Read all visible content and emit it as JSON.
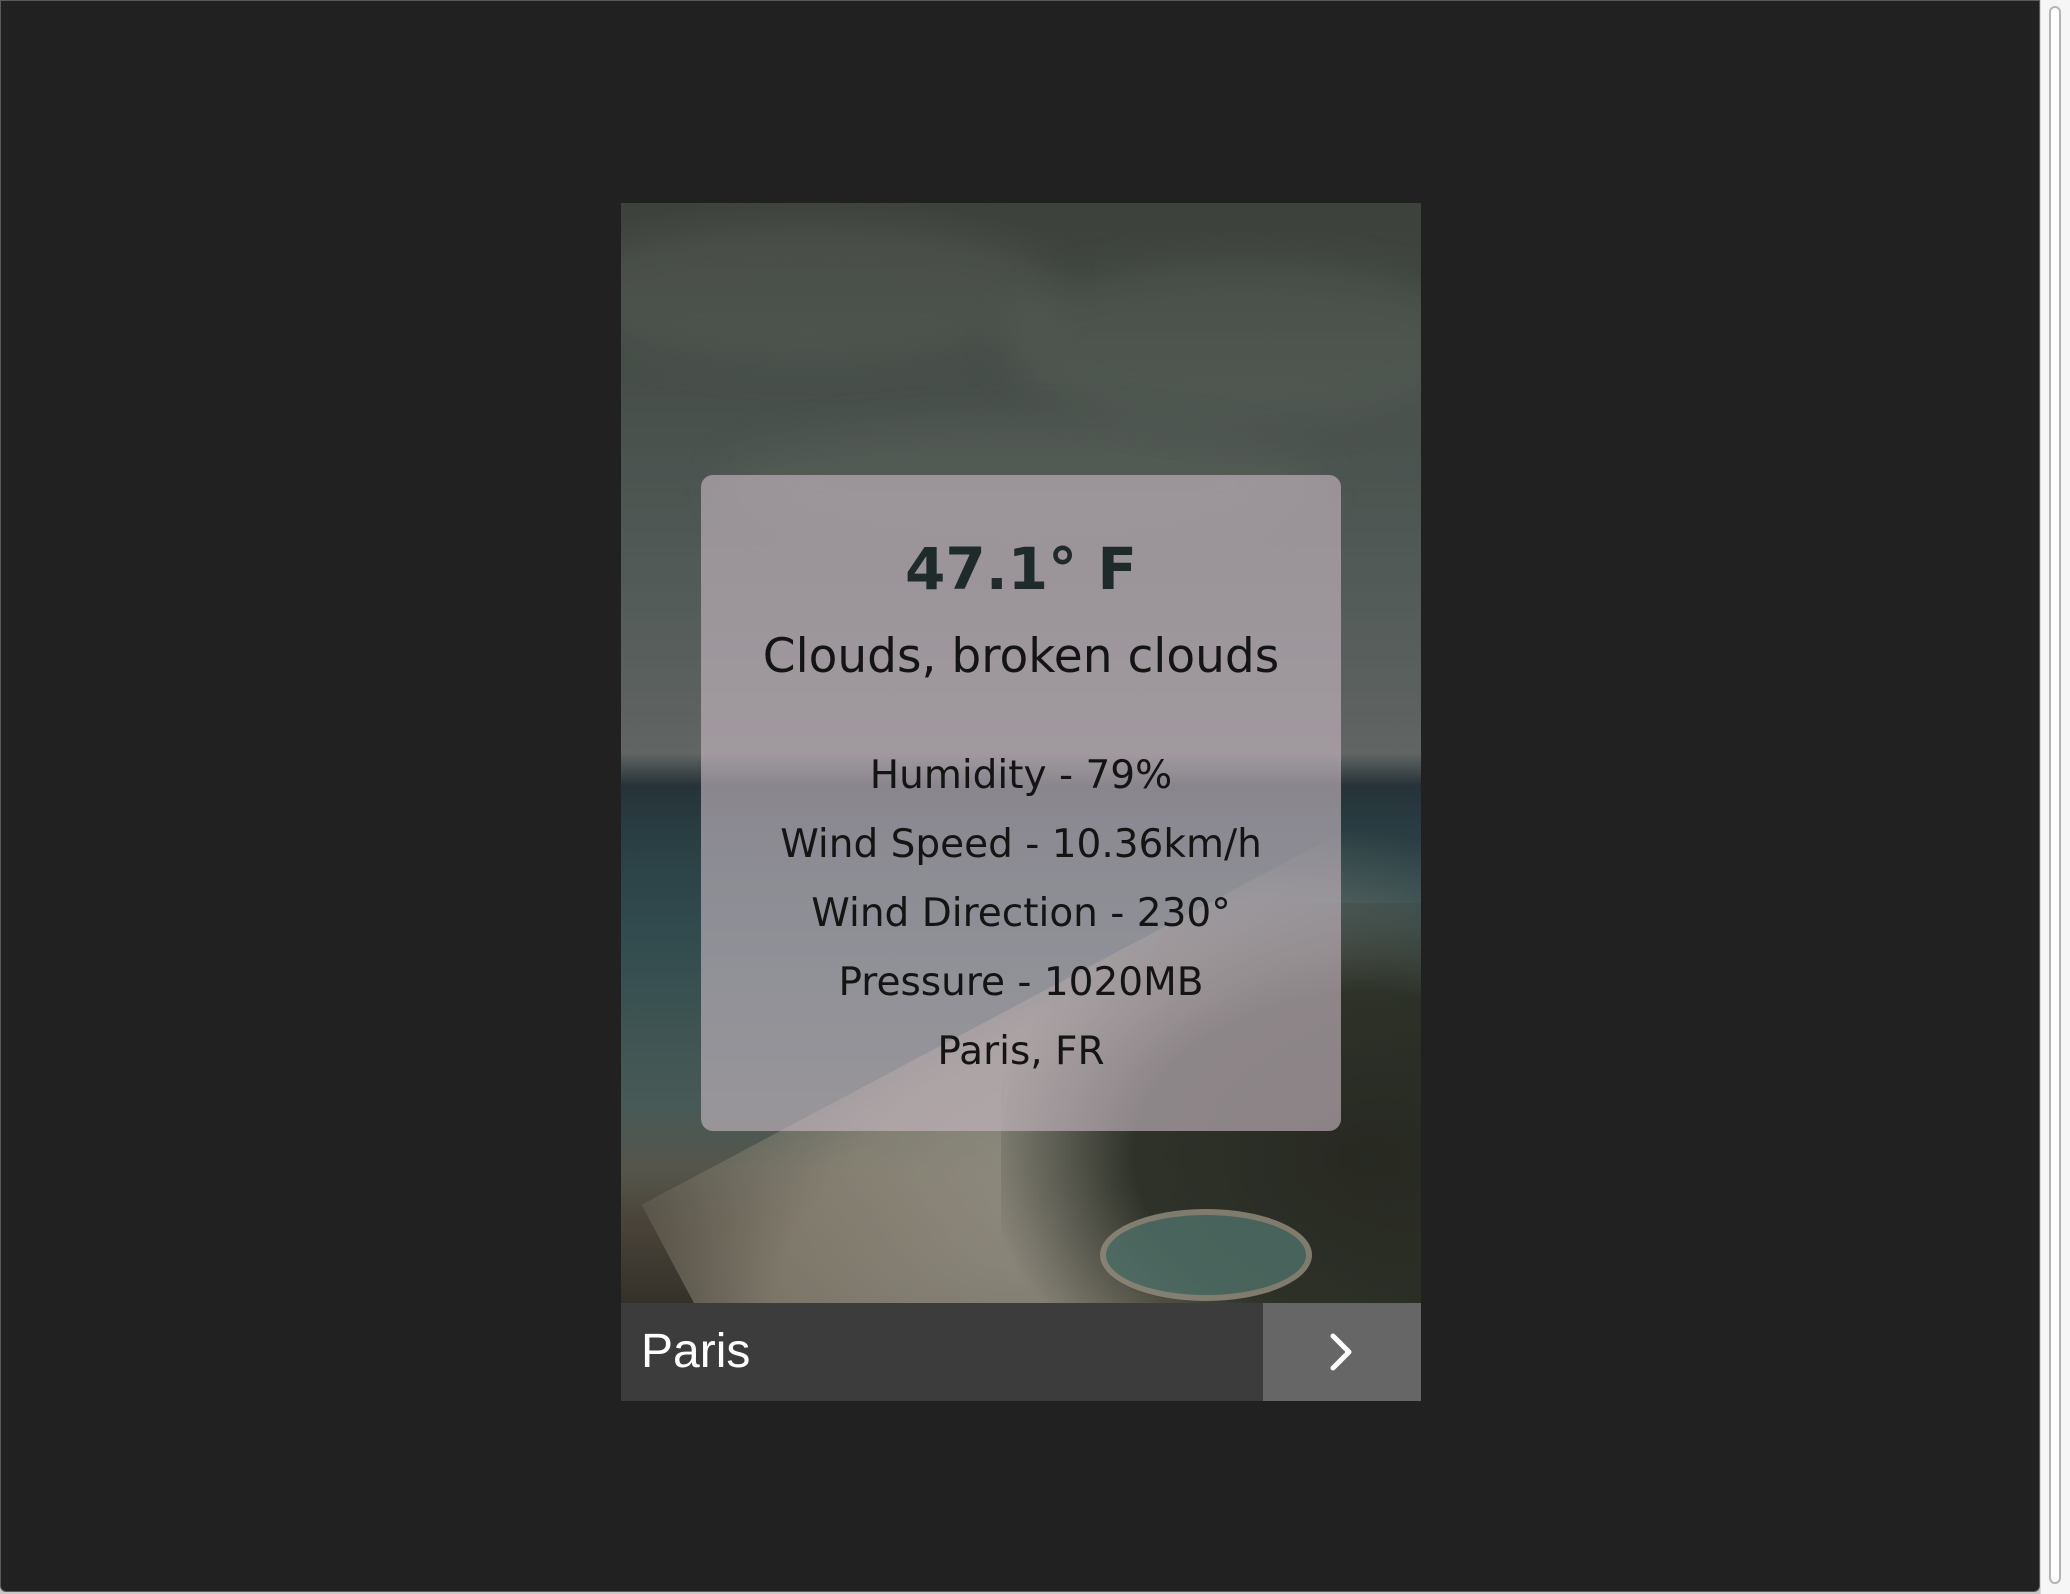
{
  "weather": {
    "temperature": "47.1° F",
    "description": "Clouds, broken clouds",
    "humidity": "Humidity - 79%",
    "wind_speed": "Wind Speed - 10.36km/h",
    "wind_direction": "Wind Direction - 230°",
    "pressure": "Pressure - 1020MB",
    "location": "Paris, FR"
  },
  "footer": {
    "city": "Paris",
    "next_icon": "chevron-right-icon"
  },
  "colors": {
    "page_background": "#212121",
    "footer_background": "#3c3c3c",
    "next_button_background": "#666666",
    "info_box_tint": "rgba(200,185,195,0.62)"
  }
}
